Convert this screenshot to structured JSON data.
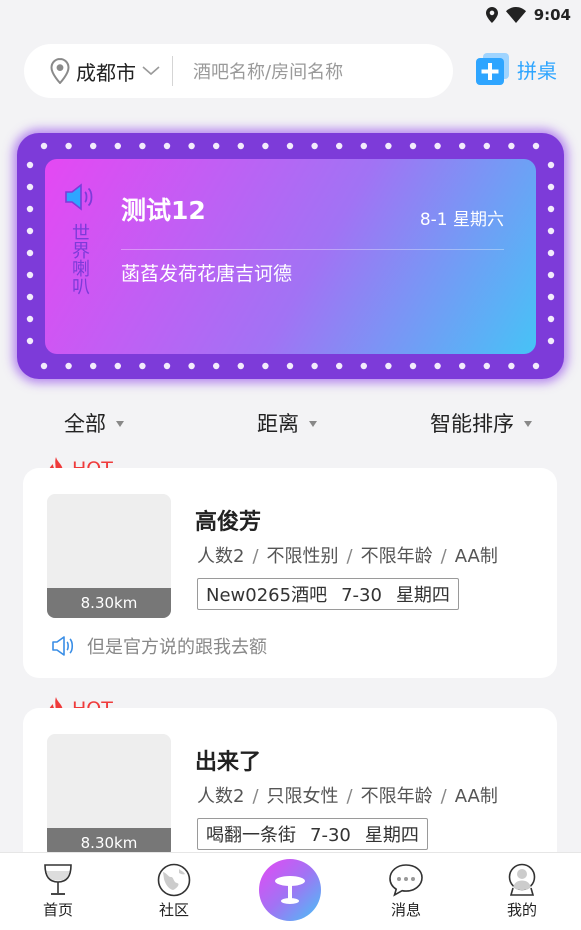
{
  "status_bar": {
    "time": "9:04"
  },
  "search": {
    "city": "成都市",
    "placeholder": "酒吧名称/房间名称",
    "pinzhuo_label": "拼桌"
  },
  "banner": {
    "speaker_label": "世界喇叭",
    "title": "测试12",
    "date": "8-1 星期六",
    "message": "菡萏发荷花唐吉诃德"
  },
  "filters": [
    {
      "label": "全部"
    },
    {
      "label": "距离"
    },
    {
      "label": "智能排序"
    }
  ],
  "hot_label": "HOT",
  "listings": [
    {
      "name": "高俊芳",
      "distance": "8.30km",
      "tags": [
        "人数2",
        "不限性别",
        "不限年龄",
        "AA制"
      ],
      "venue": "New0265酒吧",
      "date": "7-30",
      "weekday": "星期四",
      "note": "但是官方说的跟我去额"
    },
    {
      "name": "出来了",
      "distance": "8.30km",
      "tags": [
        "人数2",
        "只限女性",
        "不限年龄",
        "AA制"
      ],
      "venue": "喝翻一条街",
      "date": "7-30",
      "weekday": "星期四"
    }
  ],
  "tabbar": {
    "home": "首页",
    "community": "社区",
    "messages": "消息",
    "mine": "我的"
  },
  "colors": {
    "accent_blue": "#2ea5ff",
    "hot_red": "#ef3b3b",
    "banner_purple": "#7d3bd9"
  }
}
